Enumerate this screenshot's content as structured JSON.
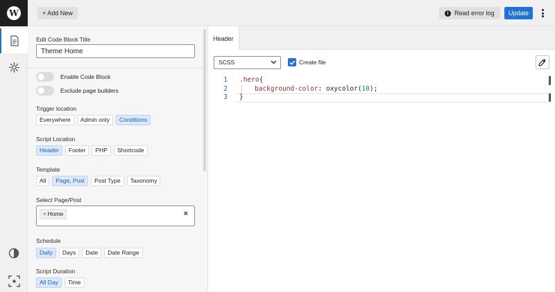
{
  "topbar": {
    "add_new_label": "+ Add New",
    "error_log_label": "Read error log",
    "update_label": "Update"
  },
  "sidebar": {
    "title_label": "Edit Code Block Title",
    "title_value": "Theme Home",
    "toggles": [
      {
        "label": "Enable Code Block",
        "on": false
      },
      {
        "label": "Exclude page builders",
        "on": false
      }
    ],
    "trigger_location": {
      "label": "Trigger location",
      "options": [
        "Everywhere",
        "Admin only",
        "Conditions"
      ],
      "selected": "Conditions"
    },
    "script_location": {
      "label": "Script Location",
      "options": [
        "Header",
        "Footer",
        "PHP",
        "Shortcode"
      ],
      "selected": "Header"
    },
    "template": {
      "label": "Template",
      "options": [
        "All",
        "Page, Post",
        "Post Type",
        "Taxonomy"
      ],
      "selected": "Page, Post"
    },
    "select_page": {
      "label": "Select Page/Post",
      "chip": "Home"
    },
    "schedule": {
      "label": "Schedule",
      "options": [
        "Daily",
        "Days",
        "Date",
        "Date Range"
      ],
      "selected": "Daily"
    },
    "script_duration": {
      "label": "Script Duration",
      "options": [
        "All Day",
        "Time"
      ],
      "selected": "All Day"
    }
  },
  "editor": {
    "tab_label": "Header",
    "language": "SCSS",
    "create_file_label": "Create file",
    "create_file_checked": true,
    "line_numbers": [
      "1",
      "2",
      "3"
    ],
    "code": {
      "selector": ".hero",
      "open_brace": "{",
      "property": "background-color",
      "colon": ": ",
      "func": "oxycolor(",
      "arg": "10",
      "close_paren": ");",
      "close_brace": "}"
    }
  },
  "colors": {
    "accent": "#2271d5",
    "selected_bg": "#dbe9fb",
    "code_selector": "#a0282c",
    "code_number": "#108a2e",
    "line_number": "#2368c9"
  },
  "icons": [
    "wordpress-icon",
    "page-icon",
    "gear-icon",
    "contrast-icon",
    "focus-icon",
    "info-icon",
    "kebab-menu-icon",
    "chevron-down-icon",
    "checkmark-icon",
    "eyedropper-icon"
  ]
}
